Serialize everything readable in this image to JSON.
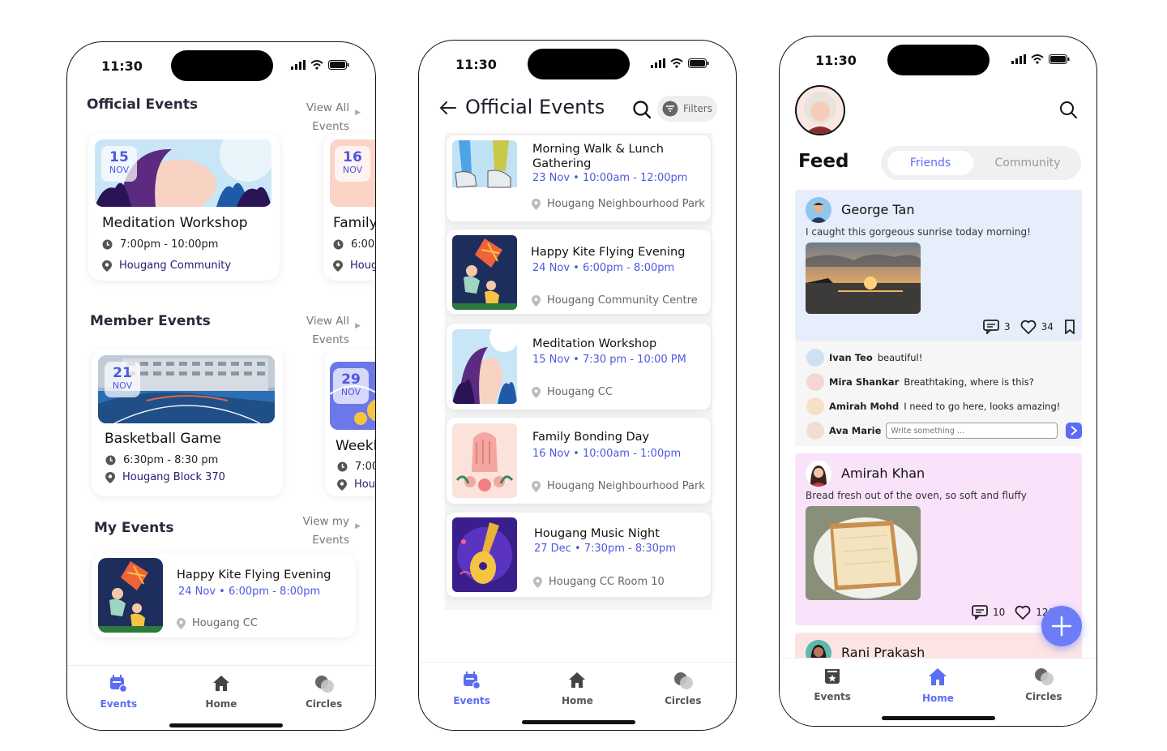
{
  "status": {
    "time": "11:30"
  },
  "nav": {
    "events": "Events",
    "home": "Home",
    "circles": "Circles"
  },
  "screen1": {
    "official": {
      "title": "Official Events",
      "view_all": "View All Events"
    },
    "official_cards": [
      {
        "day": "15",
        "month": "NOV",
        "title": "Meditation Workshop",
        "time": "7:00pm - 10:00pm",
        "location": "Hougang Community"
      },
      {
        "day": "16",
        "month": "NOV",
        "title": "Family",
        "time": "6:00",
        "location": "Houg"
      }
    ],
    "member": {
      "title": "Member Events",
      "view_all": "View All Events"
    },
    "member_cards": [
      {
        "day": "21",
        "month": "NOV",
        "title": "Basketball Game",
        "time": "6:30pm - 8:30 pm",
        "location": "Hougang Block 370"
      },
      {
        "day": "29",
        "month": "NOV",
        "title": "Weekl",
        "time": "7:00",
        "location": "Hou"
      }
    ],
    "my": {
      "title": "My Events",
      "view_all": "View my Events"
    },
    "my_card": {
      "title": "Happy Kite Flying Evening",
      "date": "24 Nov • 6:00pm - 8:00pm",
      "location": "Hougang CC"
    }
  },
  "screen2": {
    "title": "Official Events",
    "filters": "Filters",
    "events": [
      {
        "title": "Morning Walk & Lunch Gathering",
        "date": "23 Nov • 10:00am - 12:00pm",
        "location": "Hougang Neighbourhood Park"
      },
      {
        "title": "Happy Kite Flying Evening",
        "date": "24 Nov • 6:00pm - 8:00pm",
        "location": "Hougang Community Centre"
      },
      {
        "title": "Meditation Workshop",
        "date": "15 Nov • 7:30 pm - 10:00 PM",
        "location": "Hougang CC"
      },
      {
        "title": "Family Bonding Day",
        "date": "16 Nov • 10:00am - 1:00pm",
        "location": "Hougang Neighbourhood Park"
      },
      {
        "title": "Hougang Music Night",
        "date": "27 Dec • 7:30pm - 8:30pm",
        "location": "Hougang CC Room 10"
      }
    ]
  },
  "screen3": {
    "feed_title": "Feed",
    "tabs": {
      "friends": "Friends",
      "community": "Community"
    },
    "posts": [
      {
        "author": "George Tan",
        "text": "I caught this gorgeous sunrise today morning!",
        "comments": "3",
        "likes": "34"
      },
      {
        "author": "Amirah Khan",
        "text": "Bread fresh out of the oven, so soft and fluffy",
        "comments": "10",
        "likes": "126"
      },
      {
        "author": "Rani Prakash"
      }
    ],
    "comments": [
      {
        "name": "Ivan Teo",
        "text": "beautiful!"
      },
      {
        "name": "Mira Shankar",
        "text": "Breathtaking, where is this?"
      },
      {
        "name": "Amirah Mohd",
        "text": "I need to go here, looks amazing!"
      }
    ],
    "reply": {
      "name": "Ava Marie",
      "placeholder": "Write something ..."
    }
  },
  "colors": {
    "accent": "#5b6cf6",
    "date_blue": "#4f58e0",
    "post_blue": "#e6eefb",
    "post_pink": "#f9e3fb",
    "post_peach": "#fde4e4"
  }
}
